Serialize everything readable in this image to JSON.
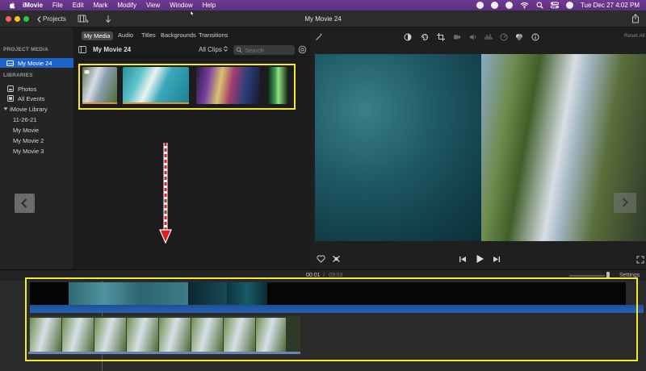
{
  "menubar": {
    "app_name": "iMovie",
    "menus": [
      "File",
      "Edit",
      "Mark",
      "Modify",
      "View",
      "Window",
      "Help"
    ],
    "clock": "Tue Dec 27  4:02 PM"
  },
  "toolbar": {
    "projects_label": "Projects",
    "window_title": "My Movie 24"
  },
  "library": {
    "project_media_header": "PROJECT MEDIA",
    "project_item": "My Movie 24",
    "libraries_header": "LIBRARIES",
    "items": [
      "Photos",
      "All Events",
      "iMovie Library",
      "11-26-21",
      "My Movie",
      "My Movie 2",
      "My Movie 3"
    ]
  },
  "browser": {
    "tabs": [
      "My Media",
      "Audio",
      "Titles",
      "Backgrounds",
      "Transitions"
    ],
    "title": "My Movie 24",
    "filter": "All Clips",
    "search_placeholder": "Search"
  },
  "viewer": {
    "reset_all": "Reset All"
  },
  "timeline": {
    "timecode": "00:01",
    "duration": "03:03",
    "settings_label": "Settings"
  },
  "colors": {
    "selection_blue": "#1f63c8",
    "annotation_yellow": "#f2ea2a",
    "arrow_red": "#e21b1b"
  }
}
